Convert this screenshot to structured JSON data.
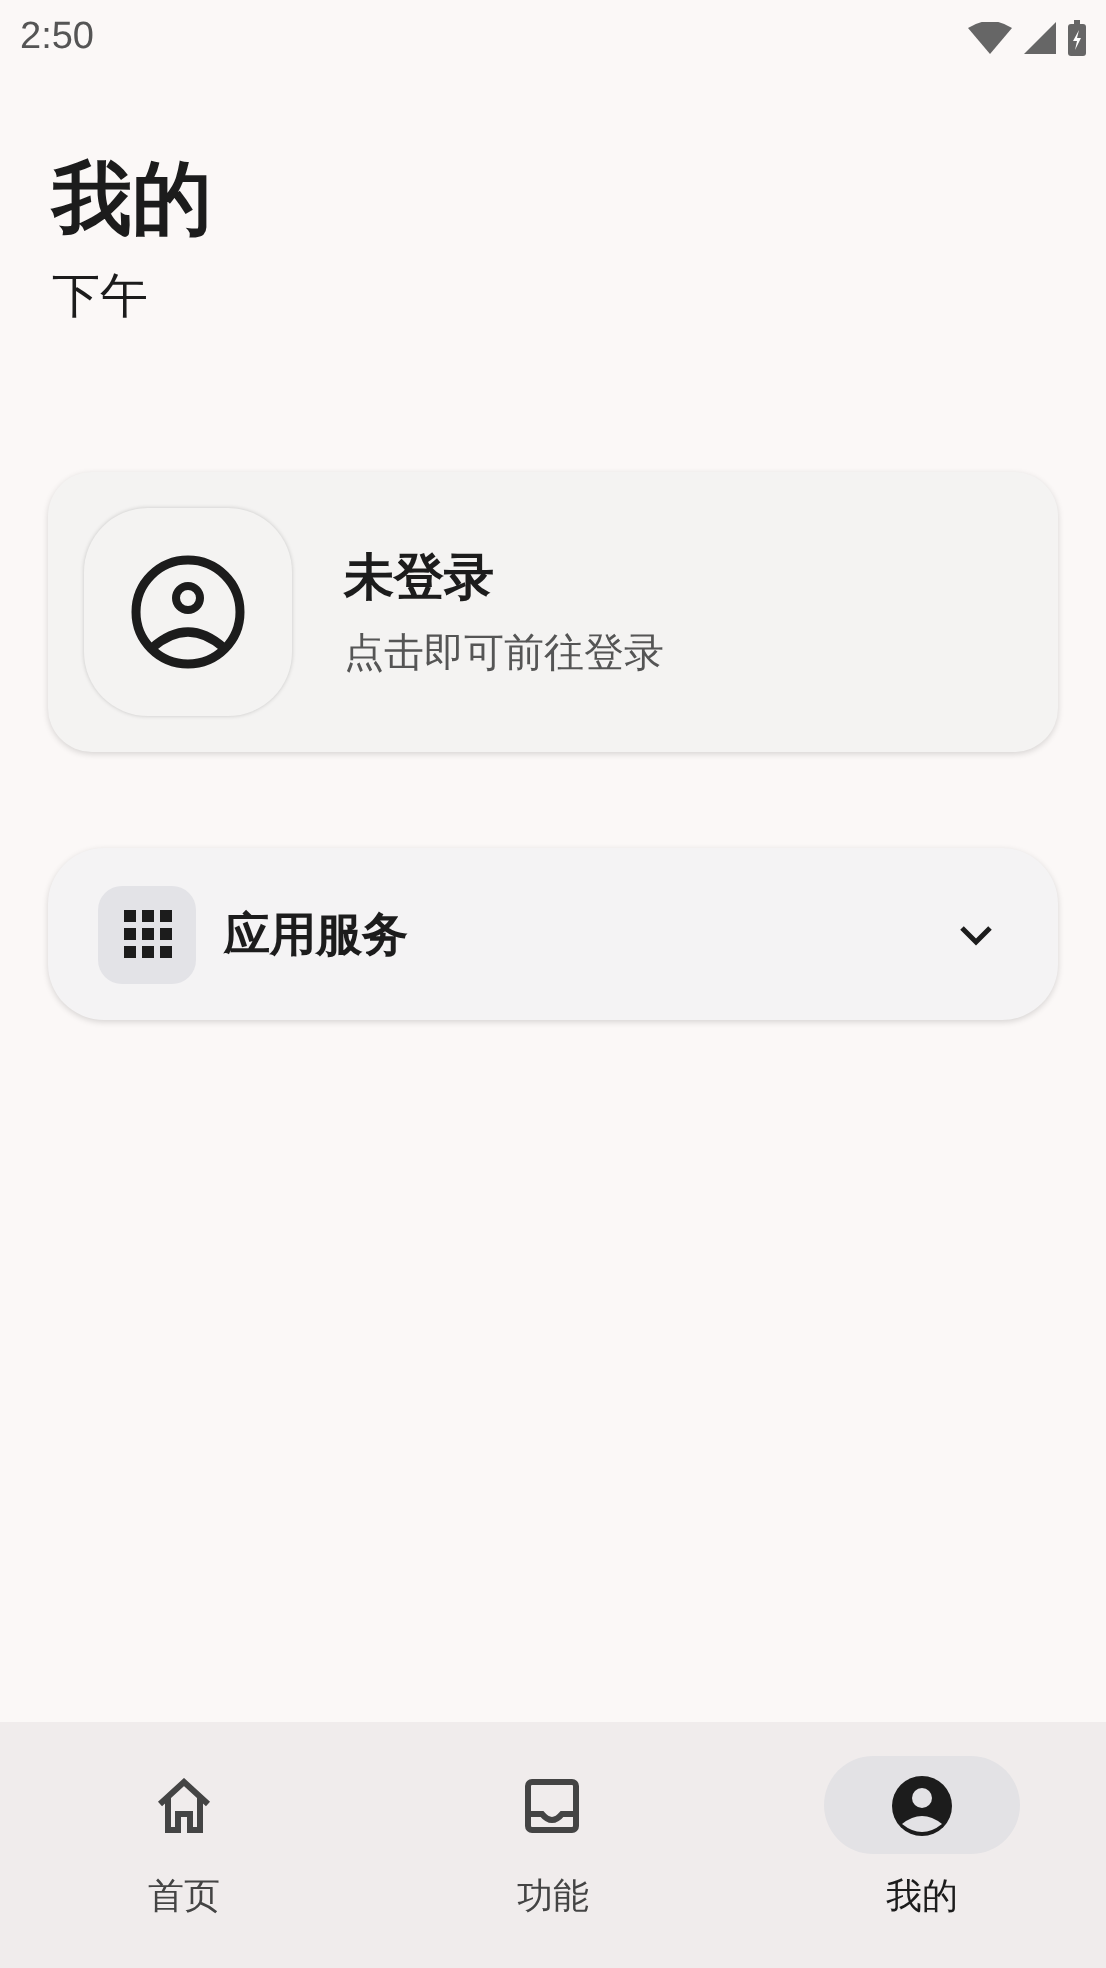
{
  "status_bar": {
    "time": "2:50"
  },
  "header": {
    "title": "我的",
    "subtitle": "下午"
  },
  "account_card": {
    "name": "未登录",
    "hint": "点击即可前往登录"
  },
  "services": {
    "label": "应用服务",
    "expanded": false
  },
  "nav_tabs": [
    {
      "kind": "home",
      "label": "首页",
      "selected": false
    },
    {
      "kind": "inbox",
      "label": "功能",
      "selected": false
    },
    {
      "kind": "profile",
      "label": "我的",
      "selected": true
    }
  ]
}
